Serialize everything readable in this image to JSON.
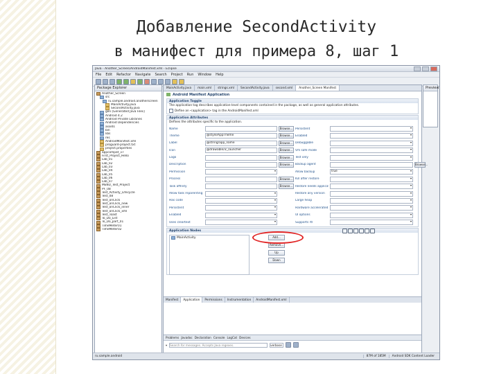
{
  "slide": {
    "title_line1": "Добавление SecondActivity",
    "title_line2": "в манифест для примера 8, шаг 1"
  },
  "window": {
    "title": "Java - Another_Screen/AndroidManifest.xml - Eclipse",
    "menu": [
      "File",
      "Edit",
      "Refactor",
      "Navigate",
      "Search",
      "Project",
      "Run",
      "Window",
      "Help"
    ]
  },
  "package_explorer": {
    "tab": "Package Explorer",
    "tree": [
      {
        "label": "Another_Screen",
        "kind": "p"
      },
      {
        "label": "src",
        "kind": "f"
      },
      {
        "label": "ru.sample.android.anotherscreen",
        "kind": "f"
      },
      {
        "label": "MainActivity.java",
        "kind": "j"
      },
      {
        "label": "SecondActivity.java",
        "kind": "j"
      },
      {
        "label": "gen [Generated Java Files]",
        "kind": "f"
      },
      {
        "label": "Android 4.2",
        "kind": "f"
      },
      {
        "label": "Android Private Libraries",
        "kind": "f"
      },
      {
        "label": "Android Dependencies",
        "kind": "f"
      },
      {
        "label": "assets",
        "kind": "f"
      },
      {
        "label": "bin",
        "kind": "f"
      },
      {
        "label": "libs",
        "kind": "f"
      },
      {
        "label": "res",
        "kind": "f"
      },
      {
        "label": "AndroidManifest.xml",
        "kind": "j"
      },
      {
        "label": "proguard-project.txt",
        "kind": "j"
      },
      {
        "label": "project.properties",
        "kind": "j"
      },
      {
        "label": "appcompat_v7",
        "kind": "p"
      },
      {
        "label": "First_Project_Hello",
        "kind": "p"
      },
      {
        "label": "Lab_01",
        "kind": "p"
      },
      {
        "label": "Lab_02",
        "kind": "p"
      },
      {
        "label": "Lab_03",
        "kind": "p"
      },
      {
        "label": "Lab_04",
        "kind": "p"
      },
      {
        "label": "Lab_05",
        "kind": "p"
      },
      {
        "label": "Lab_06",
        "kind": "p"
      },
      {
        "label": "Lab_07",
        "kind": "p"
      },
      {
        "label": "MENU_Test_Project",
        "kind": "p"
      },
      {
        "label": "PF_08",
        "kind": "p"
      },
      {
        "label": "Test_Activity_Lifecycle",
        "kind": "p"
      },
      {
        "label": "Test_08",
        "kind": "p"
      },
      {
        "label": "Test_onClick",
        "kind": "p"
      },
      {
        "label": "Test_onClick_new",
        "kind": "p"
      },
      {
        "label": "Test_onClick_inner",
        "kind": "p"
      },
      {
        "label": "Test_onClick_xml",
        "kind": "p"
      },
      {
        "label": "Test_Toast",
        "kind": "p"
      },
      {
        "label": "To_Do_List",
        "kind": "p"
      },
      {
        "label": "To_Do_part_01",
        "kind": "p"
      },
      {
        "label": "TimeMeter01",
        "kind": "p"
      },
      {
        "label": "TimeMeter02",
        "kind": "p"
      }
    ]
  },
  "editor": {
    "tabs": [
      "MainActivity.java",
      "main.xml",
      "strings.xml",
      "SecondActivity.java",
      "second.xml",
      "Another_Screen Manifest"
    ],
    "header": "Android Manifest Application",
    "app_toggle": {
      "title": "Application Toggle",
      "text": "The application tag describes application-level components contained in the package, as well as general application attributes.",
      "checkbox": "Define an <application> tag in the AndroidManifest.xml"
    },
    "attributes": {
      "title": "Application Attributes",
      "subtitle": "Defines the attributes specific to the application.",
      "rows": [
        {
          "l": "Name",
          "v": "",
          "b": "Browse...",
          "l2": "Persistent",
          "v2": "",
          "b2": ""
        },
        {
          "l": "Theme",
          "v": "@style/AppTheme",
          "b": "Browse...",
          "l2": "Enabled",
          "v2": "",
          "b2": ""
        },
        {
          "l": "Label",
          "v": "@string/app_name",
          "b": "Browse...",
          "l2": "Debuggable",
          "v2": "",
          "b2": ""
        },
        {
          "l": "Icon",
          "v": "@drawable/ic_launcher",
          "b": "Browse...",
          "l2": "Vm safe mode",
          "v2": "",
          "b2": ""
        },
        {
          "l": "Logo",
          "v": "",
          "b": "Browse...",
          "l2": "Test only",
          "v2": "",
          "b2": ""
        },
        {
          "l": "Description",
          "v": "",
          "b": "Browse...",
          "l2": "Backup agent",
          "v2": "",
          "b2": "Browse..."
        },
        {
          "l": "Permission",
          "v": "",
          "b": "",
          "l2": "Allow backup",
          "v2": "true",
          "b2": ""
        },
        {
          "l": "Process",
          "v": "",
          "b": "Browse...",
          "l2": "Kill after restore",
          "v2": "",
          "b2": ""
        },
        {
          "l": "Task affinity",
          "v": "",
          "b": "Browse...",
          "l2": "Restore needs application",
          "v2": "",
          "b2": ""
        },
        {
          "l": "Allow task reparenting",
          "v": "",
          "b": "",
          "l2": "Restore any version",
          "v2": "",
          "b2": ""
        },
        {
          "l": "Has code",
          "v": "",
          "b": "",
          "l2": "Large heap",
          "v2": "",
          "b2": ""
        },
        {
          "l": "Persistent",
          "v": "",
          "b": "",
          "l2": "Hardware accelerated",
          "v2": "",
          "b2": ""
        },
        {
          "l": "Enabled",
          "v": "",
          "b": "",
          "l2": "UI options",
          "v2": "",
          "b2": ""
        },
        {
          "l": "Uses cleartext",
          "v": "",
          "b": "",
          "l2": "Supports rtl",
          "v2": "",
          "b2": ""
        }
      ]
    },
    "nodes": {
      "title": "Application Nodes",
      "items": [
        "MainActivity"
      ],
      "buttons": [
        "Add...",
        "Remove...",
        "Up",
        "Down"
      ]
    },
    "page_tabs": [
      "Manifest",
      "Application",
      "Permissions",
      "Instrumentation",
      "AndroidManifest.xml"
    ]
  },
  "console": {
    "tabs": [
      "Problems",
      "Javadoc",
      "Declaration",
      "Console",
      "LogCat",
      "Devices"
    ],
    "filter_placeholder": "Search for messages. Accepts Java regexes.",
    "level": "verbose"
  },
  "outline": {
    "items": [
      "Preview",
      "Outline"
    ]
  },
  "status": {
    "left": "ru.sample.android",
    "mem": "87M of 185M",
    "sdk": "Android SDK Content Loader"
  },
  "colors": {
    "accent": "#27466e",
    "highlight": "#e12626"
  }
}
